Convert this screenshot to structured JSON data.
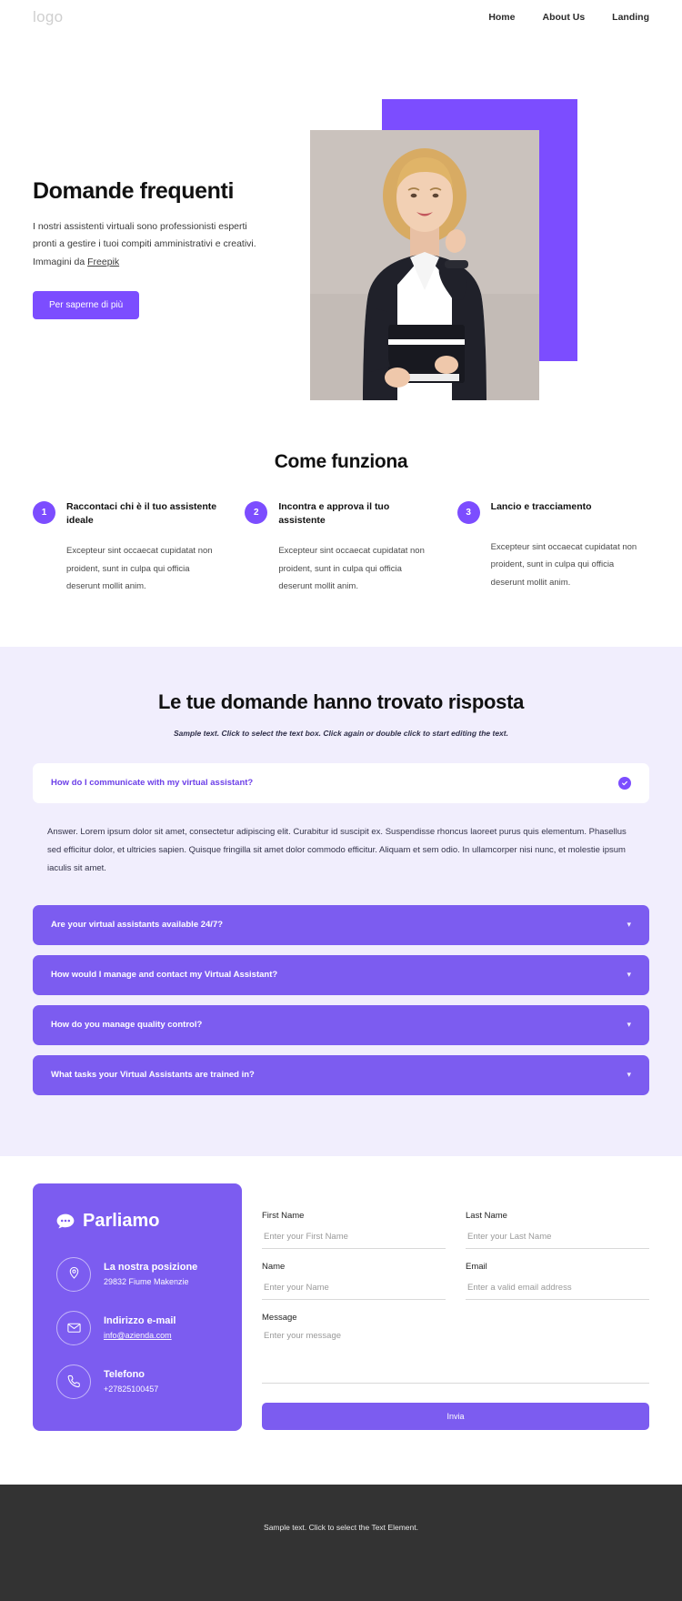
{
  "header": {
    "logo": "logo",
    "nav": [
      {
        "label": "Home"
      },
      {
        "label": "About Us"
      },
      {
        "label": "Landing"
      }
    ]
  },
  "hero": {
    "title": "Domande frequenti",
    "paragraph_line1": "I nostri assistenti virtuali sono professionisti esperti",
    "paragraph_line2": "pronti a gestire i tuoi compiti amministrativi e creativi.",
    "paragraph_line3_prefix": "Immagini da ",
    "credit_link": "Freepik",
    "cta_label": "Per saperne di più",
    "accent_color": "#7c4dff"
  },
  "how_it_works": {
    "title": "Come funziona",
    "steps": [
      {
        "number": "1",
        "title": "Raccontaci chi è il tuo assistente ideale",
        "body": "Excepteur sint occaecat cupidatat non proident, sunt in culpa qui officia deserunt mollit anim."
      },
      {
        "number": "2",
        "title": "Incontra e approva il tuo assistente",
        "body": "Excepteur sint occaecat cupidatat non proident, sunt in culpa qui officia deserunt mollit anim."
      },
      {
        "number": "3",
        "title": "Lancio e tracciamento",
        "body": "Excepteur sint occaecat cupidatat non proident, sunt in culpa qui officia deserunt mollit anim."
      }
    ]
  },
  "faq": {
    "title": "Le tue domande hanno trovato risposta",
    "subtitle": "Sample text. Click to select the text box. Click again or double click to start editing the text.",
    "background_color": "#f1eefd",
    "open_item": {
      "question": "How do I communicate with my virtual assistant?",
      "answer": "Answer. Lorem ipsum dolor sit amet, consectetur adipiscing elit. Curabitur id suscipit ex. Suspendisse rhoncus laoreet purus quis elementum. Phasellus sed efficitur dolor, et ultricies sapien. Quisque fringilla sit amet dolor commodo efficitur. Aliquam et sem odio. In ullamcorper nisi nunc, et molestie ipsum iaculis sit amet."
    },
    "closed_items": [
      {
        "question": "Are your virtual assistants available 24/7?"
      },
      {
        "question": "How would I manage and contact my Virtual Assistant?"
      },
      {
        "question": "How do you manage quality control?"
      },
      {
        "question": "What tasks your Virtual Assistants are trained in?"
      }
    ]
  },
  "contact": {
    "card_title": "Parliamo",
    "items": [
      {
        "icon": "location-pin-icon",
        "title": "La nostra posizione",
        "value": "29832 Fiume Makenzie",
        "is_link": false
      },
      {
        "icon": "envelope-icon",
        "title": "Indirizzo e-mail",
        "value": "info@azienda.com",
        "is_link": true
      },
      {
        "icon": "phone-icon",
        "title": "Telefono",
        "value": "+27825100457",
        "is_link": false
      }
    ],
    "form": {
      "first_name": {
        "label": "First Name",
        "placeholder": "Enter your First Name",
        "value": ""
      },
      "last_name": {
        "label": "Last Name",
        "placeholder": "Enter your Last Name",
        "value": ""
      },
      "name": {
        "label": "Name",
        "placeholder": "Enter your Name",
        "value": ""
      },
      "email": {
        "label": "Email",
        "placeholder": "Enter a valid email address",
        "value": ""
      },
      "message": {
        "label": "Message",
        "placeholder": "Enter your message",
        "value": ""
      },
      "submit_label": "Invia"
    }
  },
  "footer": {
    "text": "Sample text. Click to select the Text Element.",
    "background_color": "#333333"
  }
}
